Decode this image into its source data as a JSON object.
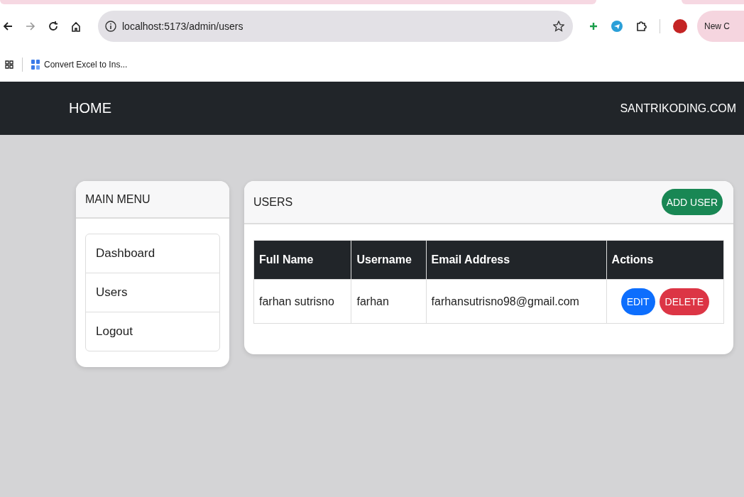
{
  "browser": {
    "url": "localhost:5173/admin/users",
    "profile_chip": "New C",
    "bookmarks": [
      {
        "label": "Convert Excel to Ins..."
      }
    ]
  },
  "navbar": {
    "brand": "HOME",
    "link": "SANTRIKODING.COM"
  },
  "sidebar": {
    "title": "MAIN MENU",
    "items": [
      {
        "label": "Dashboard"
      },
      {
        "label": "Users"
      },
      {
        "label": "Logout"
      }
    ]
  },
  "users_card": {
    "title": "USERS",
    "add_button": "ADD USER",
    "table": {
      "columns": [
        "Full Name",
        "Username",
        "Email Address",
        "Actions"
      ],
      "rows": [
        {
          "full_name": "farhan sutrisno",
          "username": "farhan",
          "email": "farhansutrisno98@gmail.com",
          "actions": [
            {
              "kind": "edit",
              "label": "EDIT"
            },
            {
              "kind": "delete",
              "label": "DELETE"
            }
          ]
        }
      ]
    }
  }
}
